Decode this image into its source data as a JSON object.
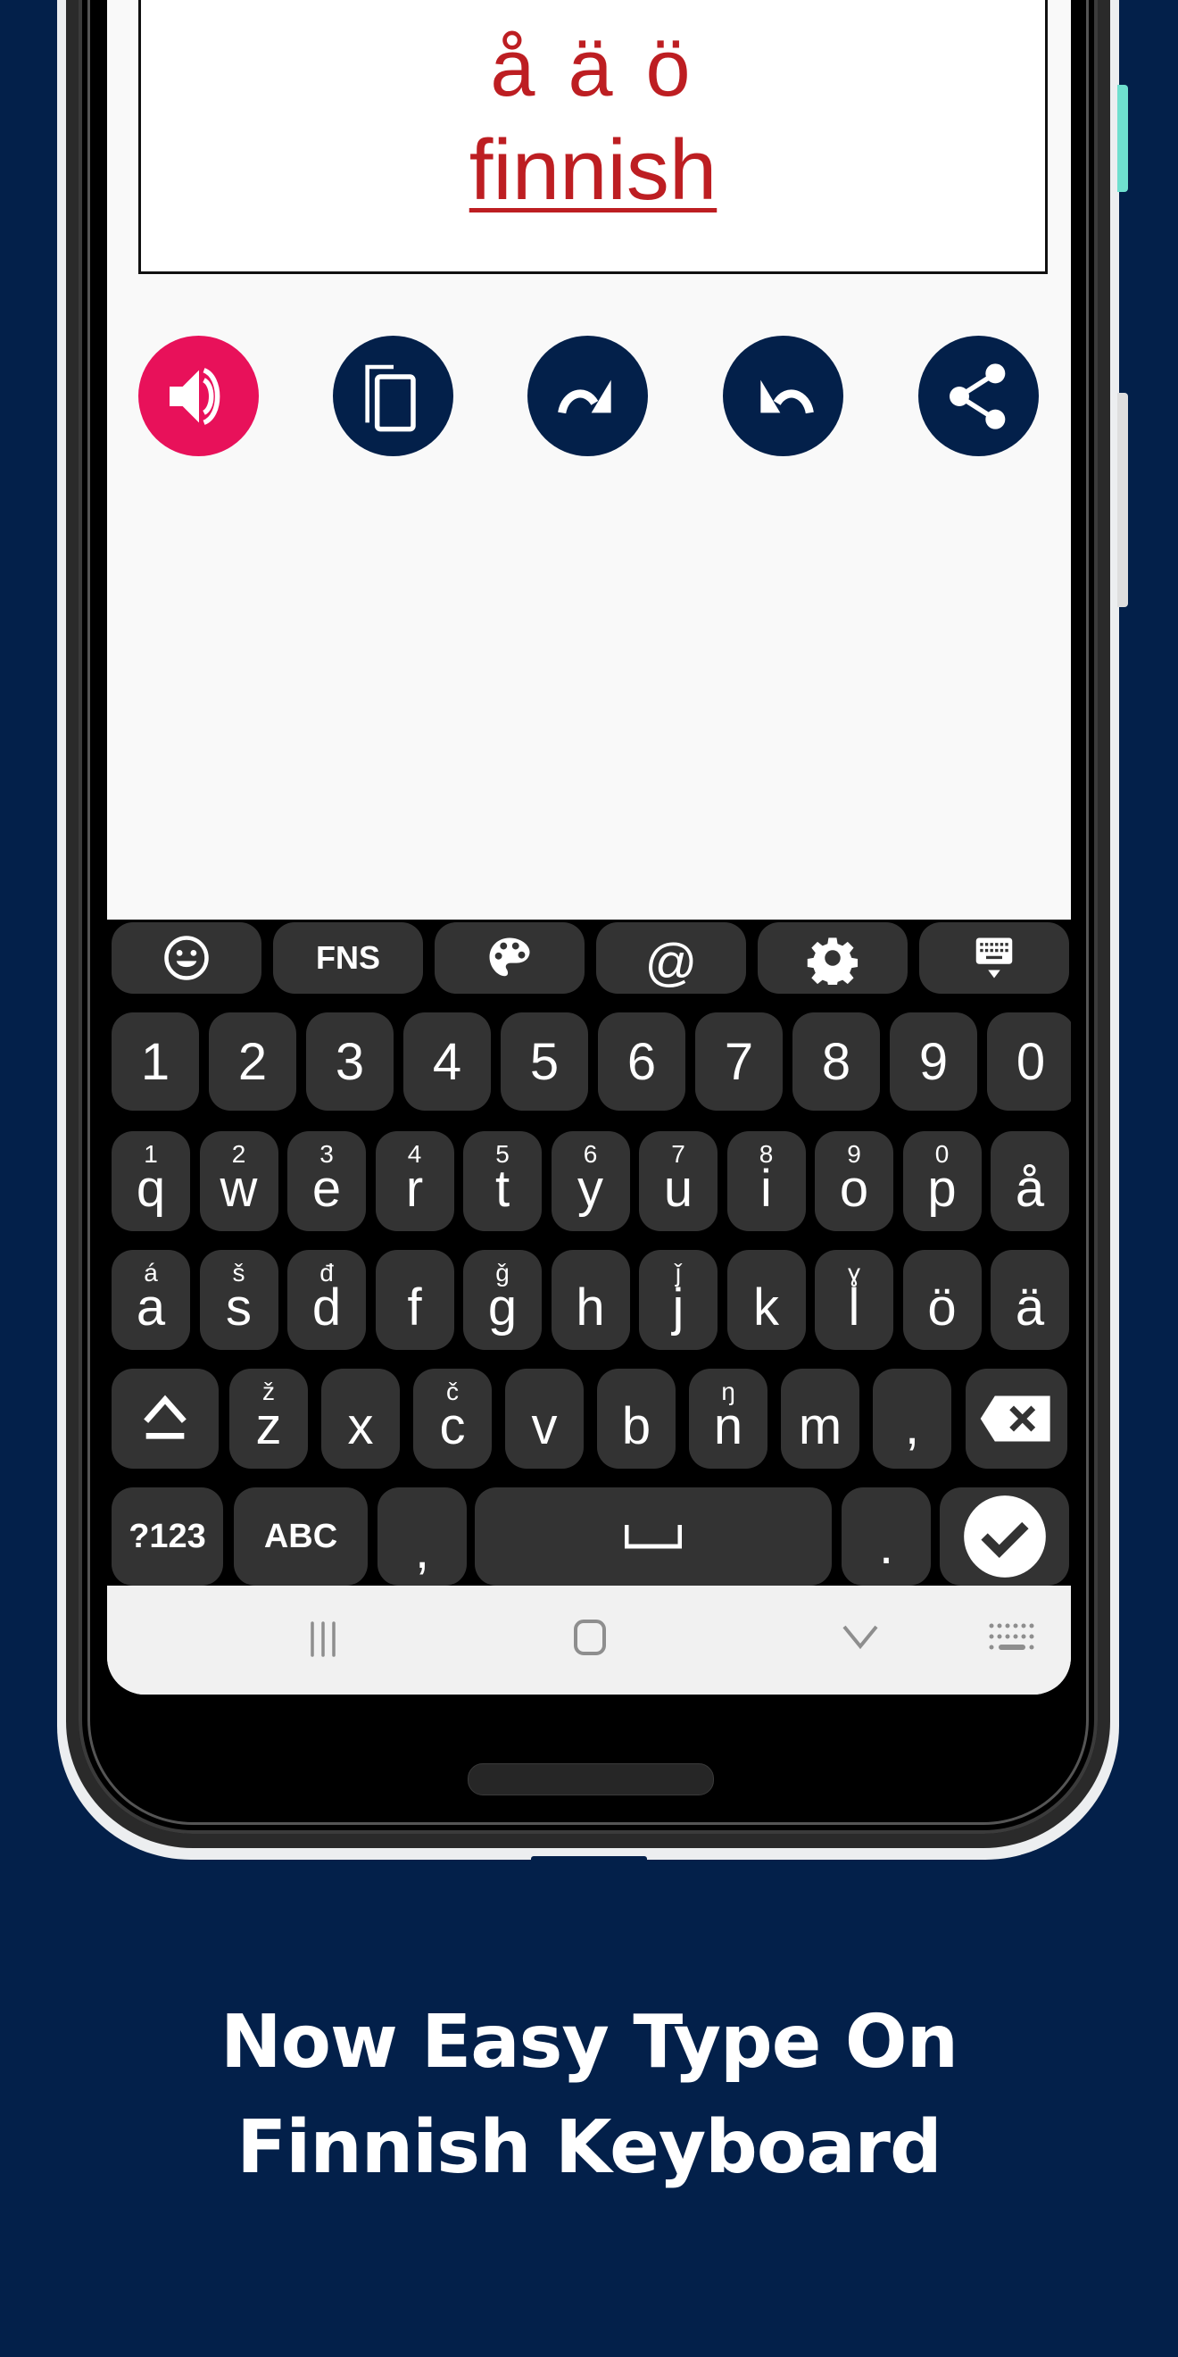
{
  "colors": {
    "background": "#03204a",
    "accent_red": "#bd1e22",
    "speaker_button": "#e8115a",
    "action_button": "#03204a",
    "key_bg": "#333333",
    "side_button_teal": "#6fe0cf"
  },
  "editor": {
    "line1": "å ä ö",
    "line2": "finnish"
  },
  "actions": [
    {
      "name": "speak",
      "icon": "speaker-icon"
    },
    {
      "name": "copy",
      "icon": "copy-icon"
    },
    {
      "name": "redo",
      "icon": "redo-icon"
    },
    {
      "name": "undo",
      "icon": "undo-icon"
    },
    {
      "name": "share",
      "icon": "share-icon"
    }
  ],
  "keyboard": {
    "toolbar": [
      {
        "name": "emoji",
        "icon": "emoji-icon"
      },
      {
        "name": "language",
        "label": "FNS"
      },
      {
        "name": "theme",
        "icon": "palette-icon"
      },
      {
        "name": "at",
        "label": "@"
      },
      {
        "name": "settings",
        "icon": "gear-icon"
      },
      {
        "name": "hide-keyboard",
        "icon": "keyboard-hide-icon"
      }
    ],
    "number_row": [
      "1",
      "2",
      "3",
      "4",
      "5",
      "6",
      "7",
      "8",
      "9",
      "0"
    ],
    "row1": [
      {
        "key": "q",
        "hint": "1"
      },
      {
        "key": "w",
        "hint": "2"
      },
      {
        "key": "e",
        "hint": "3"
      },
      {
        "key": "r",
        "hint": "4"
      },
      {
        "key": "t",
        "hint": "5"
      },
      {
        "key": "y",
        "hint": "6"
      },
      {
        "key": "u",
        "hint": "7"
      },
      {
        "key": "i",
        "hint": "8"
      },
      {
        "key": "o",
        "hint": "9"
      },
      {
        "key": "p",
        "hint": "0"
      },
      {
        "key": "å",
        "hint": ""
      }
    ],
    "row2": [
      {
        "key": "a",
        "hint": "á"
      },
      {
        "key": "s",
        "hint": "š"
      },
      {
        "key": "d",
        "hint": "đ"
      },
      {
        "key": "f",
        "hint": ""
      },
      {
        "key": "g",
        "hint": "ǧ"
      },
      {
        "key": "h",
        "hint": ""
      },
      {
        "key": "j",
        "hint": "ǰ"
      },
      {
        "key": "k",
        "hint": ""
      },
      {
        "key": "l",
        "hint": "ɣ"
      },
      {
        "key": "ö",
        "hint": ""
      },
      {
        "key": "ä",
        "hint": ""
      }
    ],
    "row3": [
      {
        "key": "z",
        "hint": "ž"
      },
      {
        "key": "x",
        "hint": ""
      },
      {
        "key": "c",
        "hint": "č"
      },
      {
        "key": "v",
        "hint": ""
      },
      {
        "key": "b",
        "hint": ""
      },
      {
        "key": "n",
        "hint": "ŋ"
      },
      {
        "key": "m",
        "hint": ""
      },
      {
        "key": ",",
        "hint": ""
      }
    ],
    "bottom": {
      "symbols_label": "?123",
      "abc_label": "ABC",
      "comma": ",",
      "period": "."
    }
  },
  "navbar": {
    "recent": "recent-apps-icon",
    "home": "home-icon",
    "back": "back-chevron-icon",
    "keyboard": "keyboard-switch-icon"
  },
  "headline": {
    "line1": "Now Easy Type On",
    "line2": "Finnish Keyboard"
  }
}
